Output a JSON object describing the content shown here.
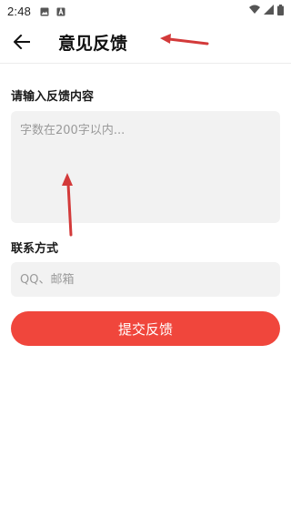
{
  "status_bar": {
    "time": "2:48",
    "icons": [
      "image-notification-icon",
      "a-notification-icon",
      "wifi-icon",
      "cellular-signal-icon",
      "battery-icon"
    ]
  },
  "header": {
    "title": "意见反馈",
    "back_icon": "arrow-left-icon"
  },
  "form": {
    "content_label": "请输入反馈内容",
    "content_placeholder": "字数在200字以内...",
    "contact_label": "联系方式",
    "contact_placeholder": "QQ、邮箱",
    "submit_label": "提交反馈"
  },
  "colors": {
    "accent": "#f0463c",
    "field_bg": "#f2f2f2",
    "annotation_arrow": "#d33a3a"
  }
}
